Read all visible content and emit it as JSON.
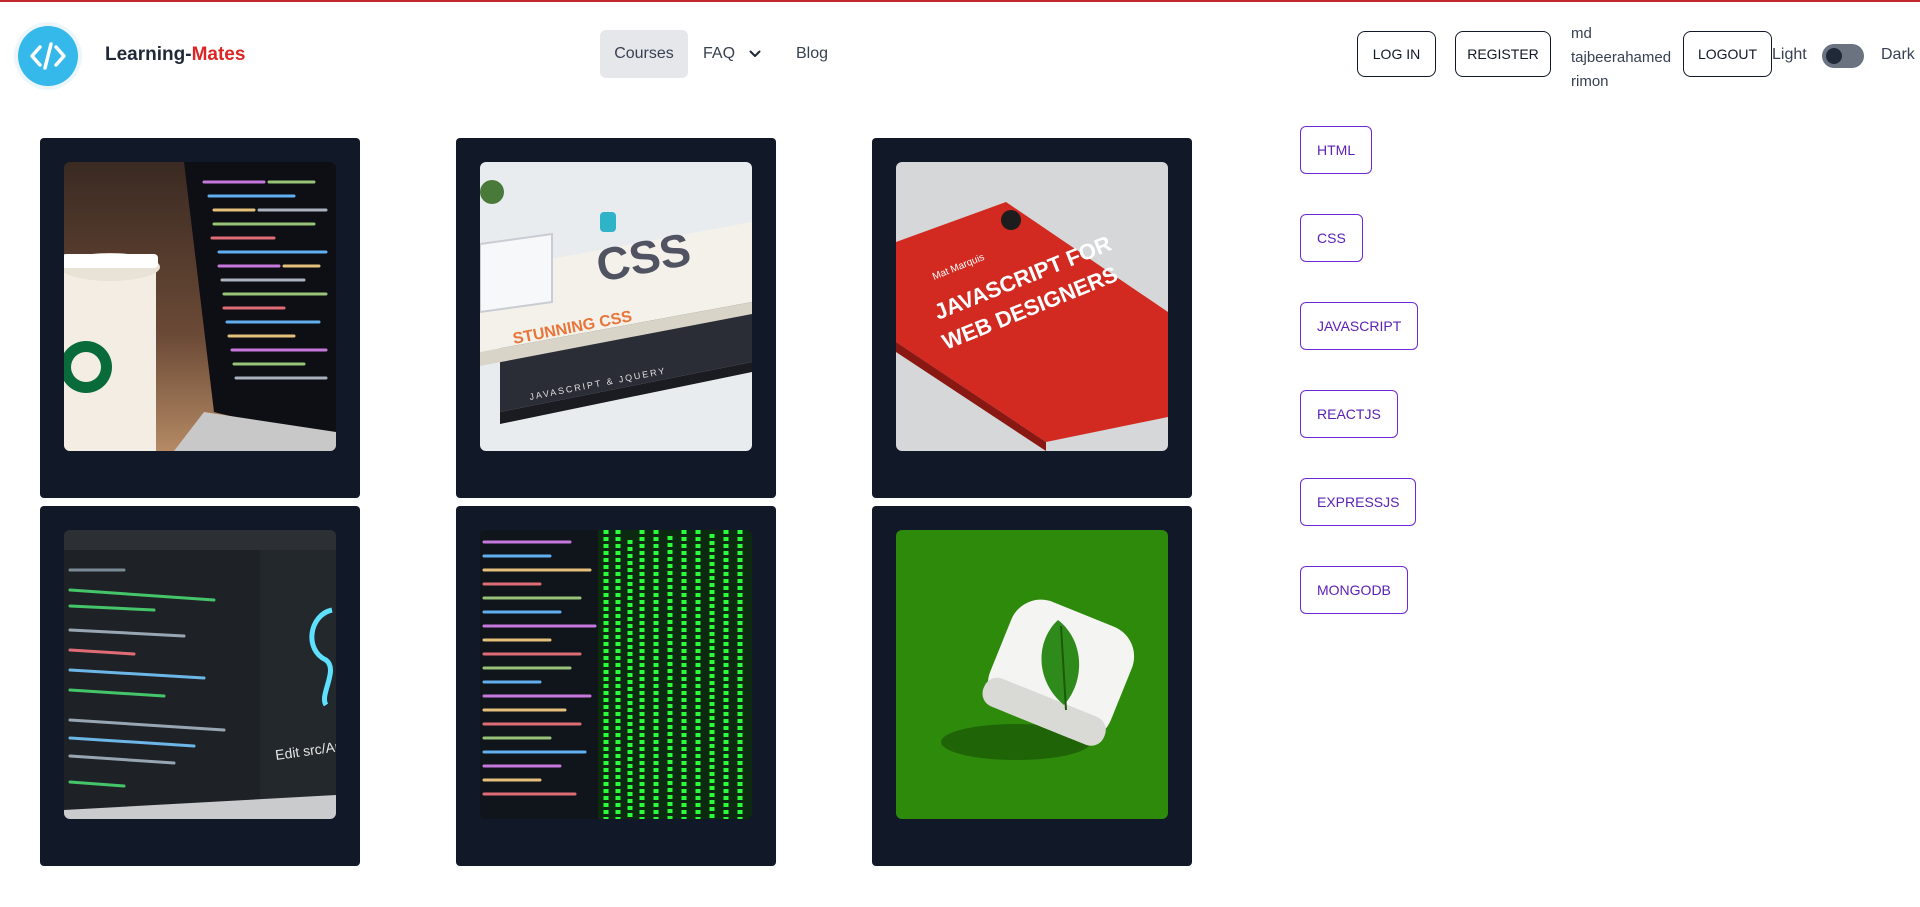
{
  "brand": {
    "prefix": "Learning-",
    "accent": "Mates",
    "accent_color": "#dc2626",
    "logo_icon": "code-icon"
  },
  "nav": {
    "courses": "Courses",
    "faq": "FAQ",
    "blog": "Blog"
  },
  "auth": {
    "login": "LOG IN",
    "register": "REGISTER",
    "user_line1": "md",
    "user_line2": "tajbeerahamed",
    "user_line3": "rimon",
    "logout": "LOGOUT"
  },
  "theme": {
    "light": "Light",
    "dark": "Dark",
    "dark_mode_on": false
  },
  "courses": [
    {
      "image": "coffee-cup-laptop-code-photo"
    },
    {
      "image": "css-javascript-books-photo"
    },
    {
      "image": "javascript-for-web-designers-book-photo"
    },
    {
      "image": "code-editor-screen-photo"
    },
    {
      "image": "green-code-terminal-photo"
    },
    {
      "image": "mongodb-leaf-logo-photo"
    }
  ],
  "categories": [
    "HTML",
    "CSS",
    "JAVASCRIPT",
    "REACTJS",
    "EXPRESSJS",
    "MONGODB"
  ],
  "photo_text": {
    "book1_title": "STUNNING CSS",
    "book1_spine": "CSS",
    "book2_spine": "JAVASCRIPT & JQUERY",
    "book3_author": "Mat Marquis",
    "book3_title_line1": "JAVASCRIPT FOR",
    "book3_title_line2": "WEB DESIGNERS",
    "editor_text": "Edit src/App"
  },
  "colors": {
    "card_bg": "#111827",
    "category_border": "#6d28d9",
    "category_text": "#5b21b6",
    "top_rule": "#c1272d"
  }
}
